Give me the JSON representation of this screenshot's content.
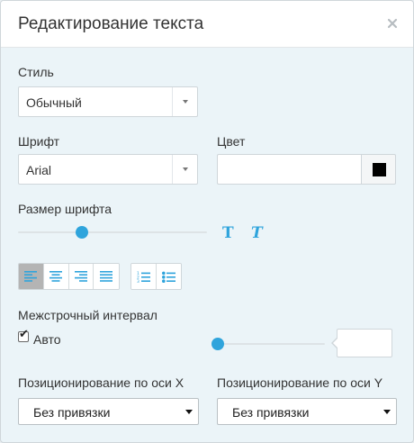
{
  "dialog": {
    "title": "Редактирование текста"
  },
  "style": {
    "label": "Стиль",
    "value": "Обычный"
  },
  "font": {
    "label": "Шрифт",
    "value": "Arial"
  },
  "color": {
    "label": "Цвет",
    "value": "",
    "swatch": "#000000"
  },
  "font_size": {
    "label": "Размер шрифта",
    "level": 0.34,
    "bold_icon": "bold-T-icon",
    "italic_icon": "italic-T-icon"
  },
  "alignment": {
    "buttons": [
      "align-left-icon",
      "align-center-icon",
      "align-right-icon",
      "align-justify-icon"
    ],
    "active": "align-left-icon",
    "list_buttons": [
      "numbered-list-icon",
      "bulleted-list-icon"
    ]
  },
  "line_spacing": {
    "label": "Межстрочный интервал",
    "auto_label": "Авто",
    "auto_checked": true,
    "level": 0.0,
    "value": ""
  },
  "position_x": {
    "label": "Позиционирование по оси X",
    "value": "Без привязки"
  },
  "position_y": {
    "label": "Позиционирование по оси Y",
    "value": "Без привязки"
  },
  "colors": {
    "accent": "#2fa4dc",
    "panel": "#ebf4f8",
    "active_button": "#b4b4b4"
  }
}
